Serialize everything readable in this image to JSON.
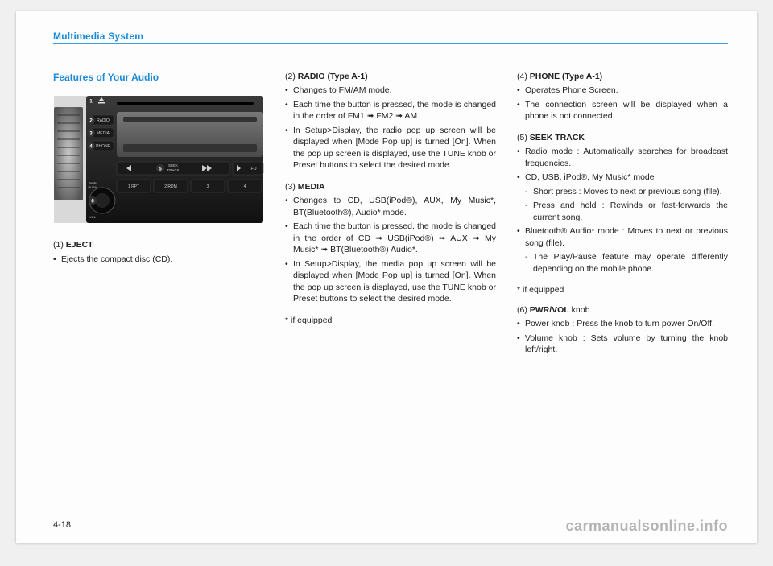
{
  "header": {
    "title": "Multimedia System"
  },
  "pageNumber": "4-18",
  "watermark": "carmanualsonline.info",
  "col1": {
    "sectionTitle": "Features of Your Audio",
    "s1": {
      "head_num": "(1) ",
      "head_bold": "EJECT",
      "b1": "Ejects the compact disc (CD)."
    }
  },
  "col2": {
    "s2": {
      "head_num": "(2) ",
      "head_bold": "RADIO (Type A-1)",
      "b1": "Changes to FM/AM mode.",
      "b2": "Each time the button is pressed, the mode is changed in the order of FM1 ➟ FM2 ➟ AM.",
      "b3a": "In Setup>Display, the radio pop up screen will be displayed when [Mode Pop up] is turned [On]. When the pop up screen is displayed, use the ",
      "b3b": "TUNE",
      "b3c": " knob or Preset buttons to select the desired mode."
    },
    "s3": {
      "head_num": "(3) ",
      "head_bold": "MEDIA",
      "b1": "Changes to CD, USB(iPod®), AUX, My Music*, BT(Bluetooth®), Audio* mode.",
      "b2": "Each time the button is pressed, the mode is changed in the order of CD ➟ USB(iPod®) ➟ AUX ➟ My Music* ➟ BT(Bluetooth®) Audio*.",
      "b3a": "In Setup>Display, the media pop up screen will be displayed when [Mode Pop up] is turned [On]. When the pop up screen is displayed, use the ",
      "b3b": "TUNE",
      "b3c": " knob or Preset buttons to select the desired mode."
    },
    "note1": "* if equipped"
  },
  "col3": {
    "s4": {
      "head_num": "(4) ",
      "head_bold": "PHONE (Type A-1)",
      "b1": "Operates Phone Screen.",
      "b2": "The connection screen will be displayed when a phone is not connected."
    },
    "s5": {
      "head_num": "(5) ",
      "head_bold": "SEEK TRACK",
      "b1": "Radio mode : Automatically searches for broadcast frequencies.",
      "b2": "CD, USB, iPod®, My Music* mode",
      "b2s1": "Short press : Moves to next or previous song (file).",
      "b2s2": "Press and hold : Rewinds or fast-forwards the current song.",
      "b3": "Bluetooth® Audio* mode : Moves to next or previous song (file).",
      "b3s1": "The Play/Pause feature may operate differently depending on the mobile phone."
    },
    "note2": "* if equipped",
    "s6": {
      "head_num": "(6) ",
      "head_bold": "PWR/VOL",
      "head_tail": " knob",
      "b1": "Power knob : Press the knob to turn power On/Off.",
      "b2": "Volume knob : Sets volume by turning the knob left/right."
    }
  },
  "figure": {
    "labels": {
      "l1": "1",
      "l2": "2",
      "l3": "3",
      "l4": "4",
      "l5": "5",
      "l6": "6"
    },
    "text": {
      "radio": "RADIO",
      "media": "MEDIA",
      "phone": "PHONE",
      "seek": "SEEK",
      "track": "TRACK",
      "fo": "FO",
      "b1": "1 RPT",
      "b2": "2 RDM",
      "b3": "3",
      "b4": "4",
      "pwr": "PWR",
      "push": "PUSH",
      "vol": "VOL"
    }
  }
}
